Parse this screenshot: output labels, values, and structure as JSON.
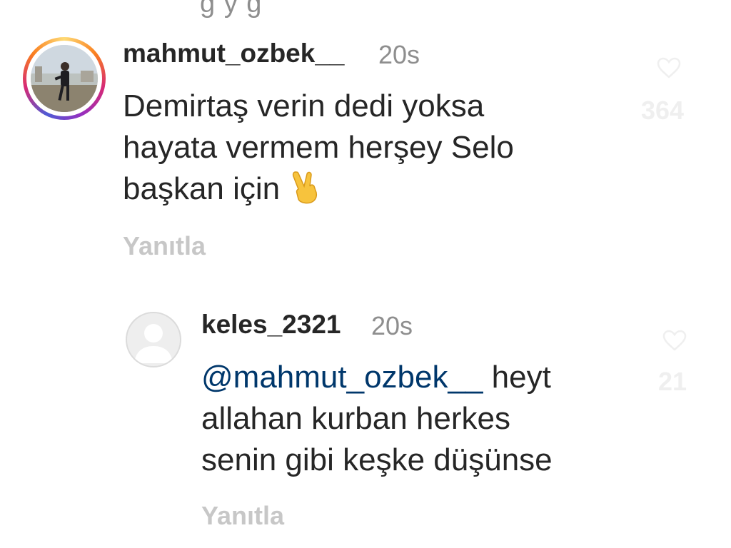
{
  "comments": [
    {
      "username": "mahmut_ozbek__",
      "time": "20s",
      "text": "Demirtaş verin dedi yoksa hayata vermem herşey Selo başkan için",
      "lines": [
        "Demirtaş verin dedi yoksa",
        "hayata vermem herşey Selo",
        "başkan için"
      ],
      "emoji": "victory-hand",
      "reply_label": "Yanıtla",
      "like_count": "364",
      "avatar": "profile-photo-story-ring"
    },
    {
      "username": "keles_2321",
      "time": "20s",
      "mention": "@mahmut_ozbek__",
      "lines": [
        "heyt",
        "allahan kurban herkes",
        "senin gibi keşke düşünse"
      ],
      "reply_label": "Yanıtla",
      "like_count": "21",
      "avatar": "default-user-icon"
    }
  ],
  "colors": {
    "text": "#262626",
    "secondary": "#8e8e8e",
    "faint": "#c7c7c7",
    "mention": "#00376b"
  }
}
